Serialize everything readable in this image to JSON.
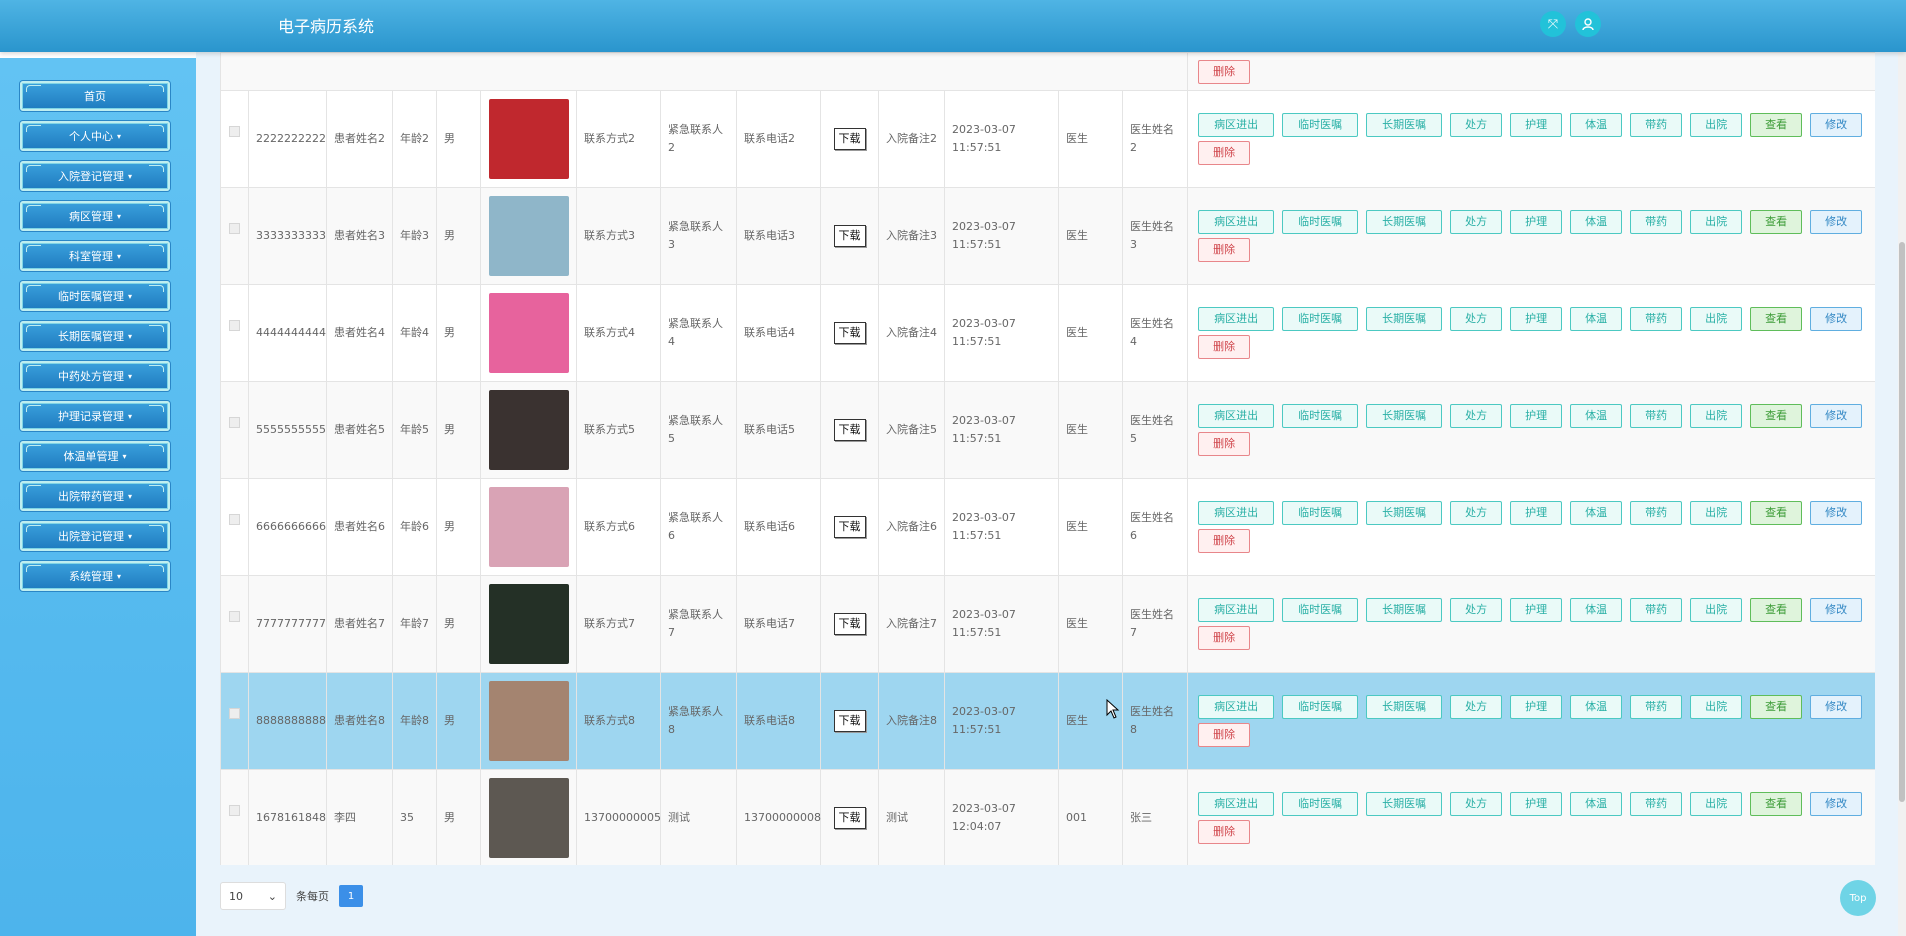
{
  "header": {
    "title": "电子病历系统",
    "fullscreen_icon": "expand-icon",
    "user_icon": "user-icon"
  },
  "sidebar": {
    "items": [
      {
        "label": "首页",
        "caret": ""
      },
      {
        "label": "个人中心",
        "caret": "▾"
      },
      {
        "label": "入院登记管理",
        "caret": "▾"
      },
      {
        "label": "病区管理",
        "caret": "▾"
      },
      {
        "label": "科室管理",
        "caret": "▾"
      },
      {
        "label": "临时医嘱管理",
        "caret": "▾"
      },
      {
        "label": "长期医嘱管理",
        "caret": "▾"
      },
      {
        "label": "中药处方管理",
        "caret": "▾"
      },
      {
        "label": "护理记录管理",
        "caret": "▾"
      },
      {
        "label": "体温单管理",
        "caret": "▾"
      },
      {
        "label": "出院带药管理",
        "caret": "▾"
      },
      {
        "label": "出院登记管理",
        "caret": "▾"
      },
      {
        "label": "系统管理",
        "caret": "▾"
      }
    ]
  },
  "table": {
    "partial_row": {
      "delete": "删除"
    },
    "rows": [
      {
        "id": "2222222222",
        "name": "患者姓名2",
        "age": "年龄2",
        "gender": "男",
        "photo_color": "#c0282e",
        "contact": "联系方式2",
        "emergency_contact": "紧急联系人2",
        "emergency_phone": "联系电话2",
        "download": "下载",
        "note": "入院备注2",
        "time": "2023-03-07 11:57:51",
        "role": "医生",
        "doctor": "医生姓名2",
        "highlight": false
      },
      {
        "id": "3333333333",
        "name": "患者姓名3",
        "age": "年龄3",
        "gender": "男",
        "photo_color": "#8fb6c9",
        "contact": "联系方式3",
        "emergency_contact": "紧急联系人3",
        "emergency_phone": "联系电话3",
        "download": "下载",
        "note": "入院备注3",
        "time": "2023-03-07 11:57:51",
        "role": "医生",
        "doctor": "医生姓名3",
        "highlight": false
      },
      {
        "id": "4444444444",
        "name": "患者姓名4",
        "age": "年龄4",
        "gender": "男",
        "photo_color": "#e7639d",
        "contact": "联系方式4",
        "emergency_contact": "紧急联系人4",
        "emergency_phone": "联系电话4",
        "download": "下载",
        "note": "入院备注4",
        "time": "2023-03-07 11:57:51",
        "role": "医生",
        "doctor": "医生姓名4",
        "highlight": false
      },
      {
        "id": "5555555555",
        "name": "患者姓名5",
        "age": "年龄5",
        "gender": "男",
        "photo_color": "#3a3230",
        "contact": "联系方式5",
        "emergency_contact": "紧急联系人5",
        "emergency_phone": "联系电话5",
        "download": "下载",
        "note": "入院备注5",
        "time": "2023-03-07 11:57:51",
        "role": "医生",
        "doctor": "医生姓名5",
        "highlight": false
      },
      {
        "id": "6666666666",
        "name": "患者姓名6",
        "age": "年龄6",
        "gender": "男",
        "photo_color": "#d9a3b5",
        "contact": "联系方式6",
        "emergency_contact": "紧急联系人6",
        "emergency_phone": "联系电话6",
        "download": "下载",
        "note": "入院备注6",
        "time": "2023-03-07 11:57:51",
        "role": "医生",
        "doctor": "医生姓名6",
        "highlight": false
      },
      {
        "id": "7777777777",
        "name": "患者姓名7",
        "age": "年龄7",
        "gender": "男",
        "photo_color": "#243026",
        "contact": "联系方式7",
        "emergency_contact": "紧急联系人7",
        "emergency_phone": "联系电话7",
        "download": "下载",
        "note": "入院备注7",
        "time": "2023-03-07 11:57:51",
        "role": "医生",
        "doctor": "医生姓名7",
        "highlight": false
      },
      {
        "id": "8888888888",
        "name": "患者姓名8",
        "age": "年龄8",
        "gender": "男",
        "photo_color": "#a48470",
        "contact": "联系方式8",
        "emergency_contact": "紧急联系人8",
        "emergency_phone": "联系电话8",
        "download": "下载",
        "note": "入院备注8",
        "time": "2023-03-07 11:57:51",
        "role": "医生",
        "doctor": "医生姓名8",
        "highlight": true
      },
      {
        "id": "1678161848",
        "name": "李四",
        "age": "35",
        "gender": "男",
        "photo_color": "#5d5852",
        "contact": "13700000005",
        "emergency_contact": "测试",
        "emergency_phone": "13700000008",
        "download": "下载",
        "note": "测试",
        "time": "2023-03-07 12:04:07",
        "role": "001",
        "doctor": "张三",
        "highlight": false
      }
    ],
    "actions": {
      "ward": "病区进出",
      "temp_order": "临时医嘱",
      "long_order": "长期医嘱",
      "prescription": "处方",
      "nursing": "护理",
      "temperature": "体温",
      "medication": "带药",
      "discharge": "出院",
      "view": "查看",
      "edit": "修改",
      "delete": "删除"
    }
  },
  "pagination": {
    "page_size": "10",
    "per_page_label": "条每页",
    "current_page": "1"
  },
  "scroll_top": {
    "label": "Top"
  },
  "colors": {
    "header": "#2a95cd",
    "sidebar": "#56b9ee",
    "highlight_row": "#9ed6f0",
    "accent_teal": "#2ab0a6"
  }
}
